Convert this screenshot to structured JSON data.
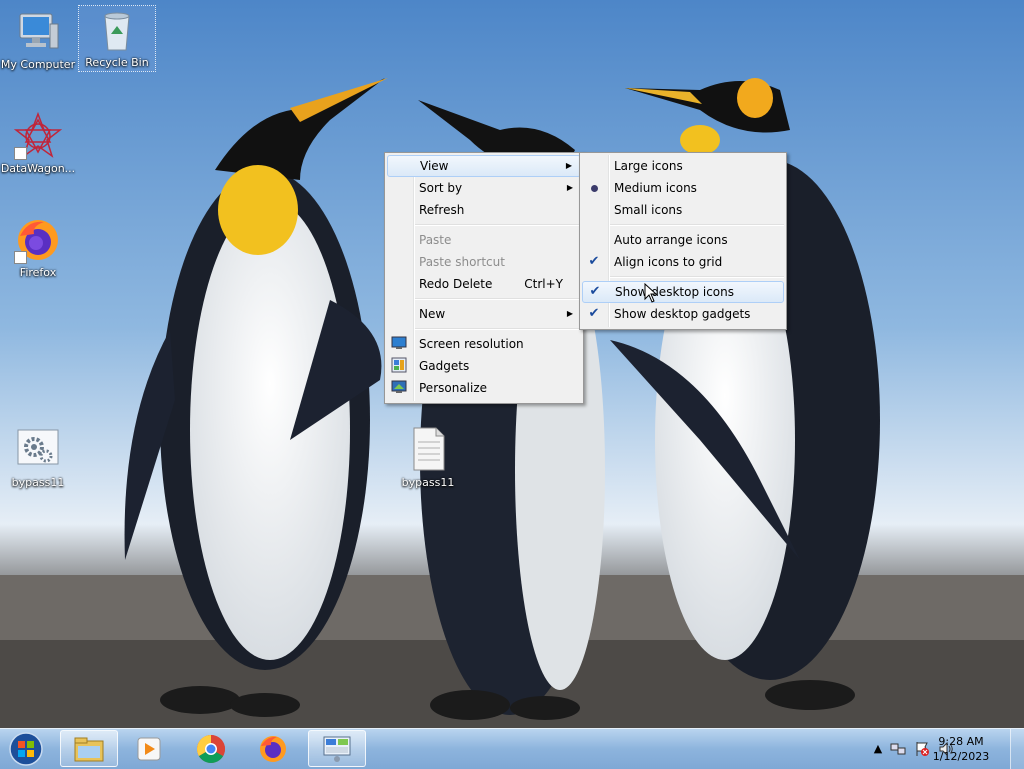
{
  "desktop": {
    "icons": [
      {
        "label": "My Computer",
        "icon": "computer-icon"
      },
      {
        "label": "Recycle Bin",
        "icon": "recycle-bin-icon"
      },
      {
        "label": "DataWagon...",
        "icon": "datawagon-icon"
      },
      {
        "label": "Firefox",
        "icon": "firefox-icon"
      },
      {
        "label": "bypass11",
        "icon": "settings-file-icon"
      },
      {
        "label": "bypass11",
        "icon": "text-file-icon"
      }
    ]
  },
  "context_menu": {
    "items": [
      {
        "label": "View"
      },
      {
        "label": "Sort by"
      },
      {
        "label": "Refresh"
      },
      {
        "label": "Paste"
      },
      {
        "label": "Paste shortcut"
      },
      {
        "label": "Redo Delete",
        "shortcut": "Ctrl+Y"
      },
      {
        "label": "New"
      },
      {
        "label": "Screen resolution"
      },
      {
        "label": "Gadgets"
      },
      {
        "label": "Personalize"
      }
    ]
  },
  "view_submenu": {
    "items": [
      {
        "label": "Large icons"
      },
      {
        "label": "Medium icons",
        "state": "selected"
      },
      {
        "label": "Small icons"
      },
      {
        "label": "Auto arrange icons"
      },
      {
        "label": "Align icons to grid",
        "state": "checked"
      },
      {
        "label": "Show desktop icons",
        "state": "checked"
      },
      {
        "label": "Show desktop gadgets",
        "state": "checked"
      }
    ]
  },
  "taskbar": {
    "pinned": [
      "windows-explorer-icon",
      "media-player-icon",
      "chrome-icon",
      "firefox-icon",
      "control-panel-icon"
    ],
    "clock": {
      "time": "9:28 AM",
      "date": "1/12/2023"
    }
  },
  "colors": {
    "menu_bg": "#f0f0f0",
    "highlight": "#dbe9f8",
    "taskbar": "#8db4dd"
  }
}
